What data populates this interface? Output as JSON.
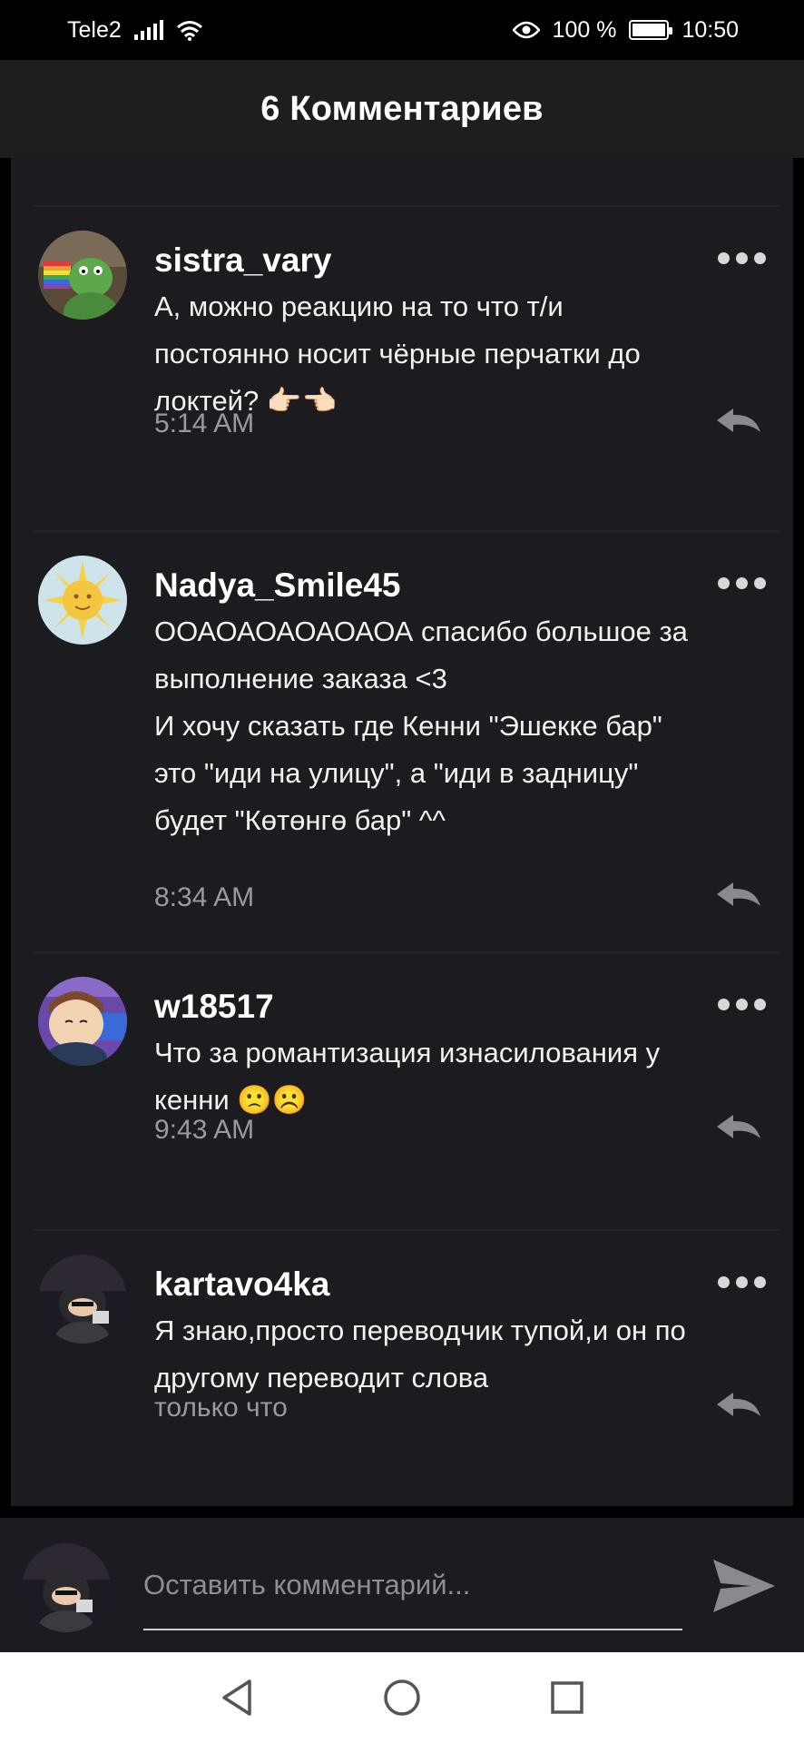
{
  "status_bar": {
    "carrier": "Tele2",
    "battery_text": "100 %",
    "time": "10:50"
  },
  "header": {
    "title": "6 Комментариев"
  },
  "comments": [
    {
      "username": "sistra_vary",
      "text": "А, можно реакцию на то что т/и\nпостоянно носит чёрные перчатки до\nлоктей? 👉🏻👈🏻",
      "time": "5:14 AM",
      "avatar_icon": "kermit-avatar"
    },
    {
      "username": "Nadya_Smile45",
      "text": "ООАОАОАОАОАОА спасибо большое за\nвыполнение заказа <3\nИ хочу сказать где Кенни \"Эшекке бар\"\nэто \"иди на улицу\", а \"иди в задницу\"\nбудет \"Көтөнгө бар\" ^^",
      "time": "8:34 AM",
      "avatar_icon": "sun-avatar"
    },
    {
      "username": "w18517",
      "text": "Что за романтизация изнасилования у\nкенни 🙁☹️",
      "time": "9:43 AM",
      "avatar_icon": "cartoon-avatar"
    },
    {
      "username": "kartavo4ka",
      "text": "Я знаю,просто переводчик тупой,и он по\nдругому переводит слова",
      "time": "только что",
      "avatar_icon": "dark-cartoon-avatar"
    }
  ],
  "input": {
    "placeholder": "Оставить комментарий..."
  },
  "colors": {
    "background": "#1c1b20",
    "header": "#1e1e20",
    "text": "#f2f2f2",
    "muted": "#9a9a9e"
  }
}
